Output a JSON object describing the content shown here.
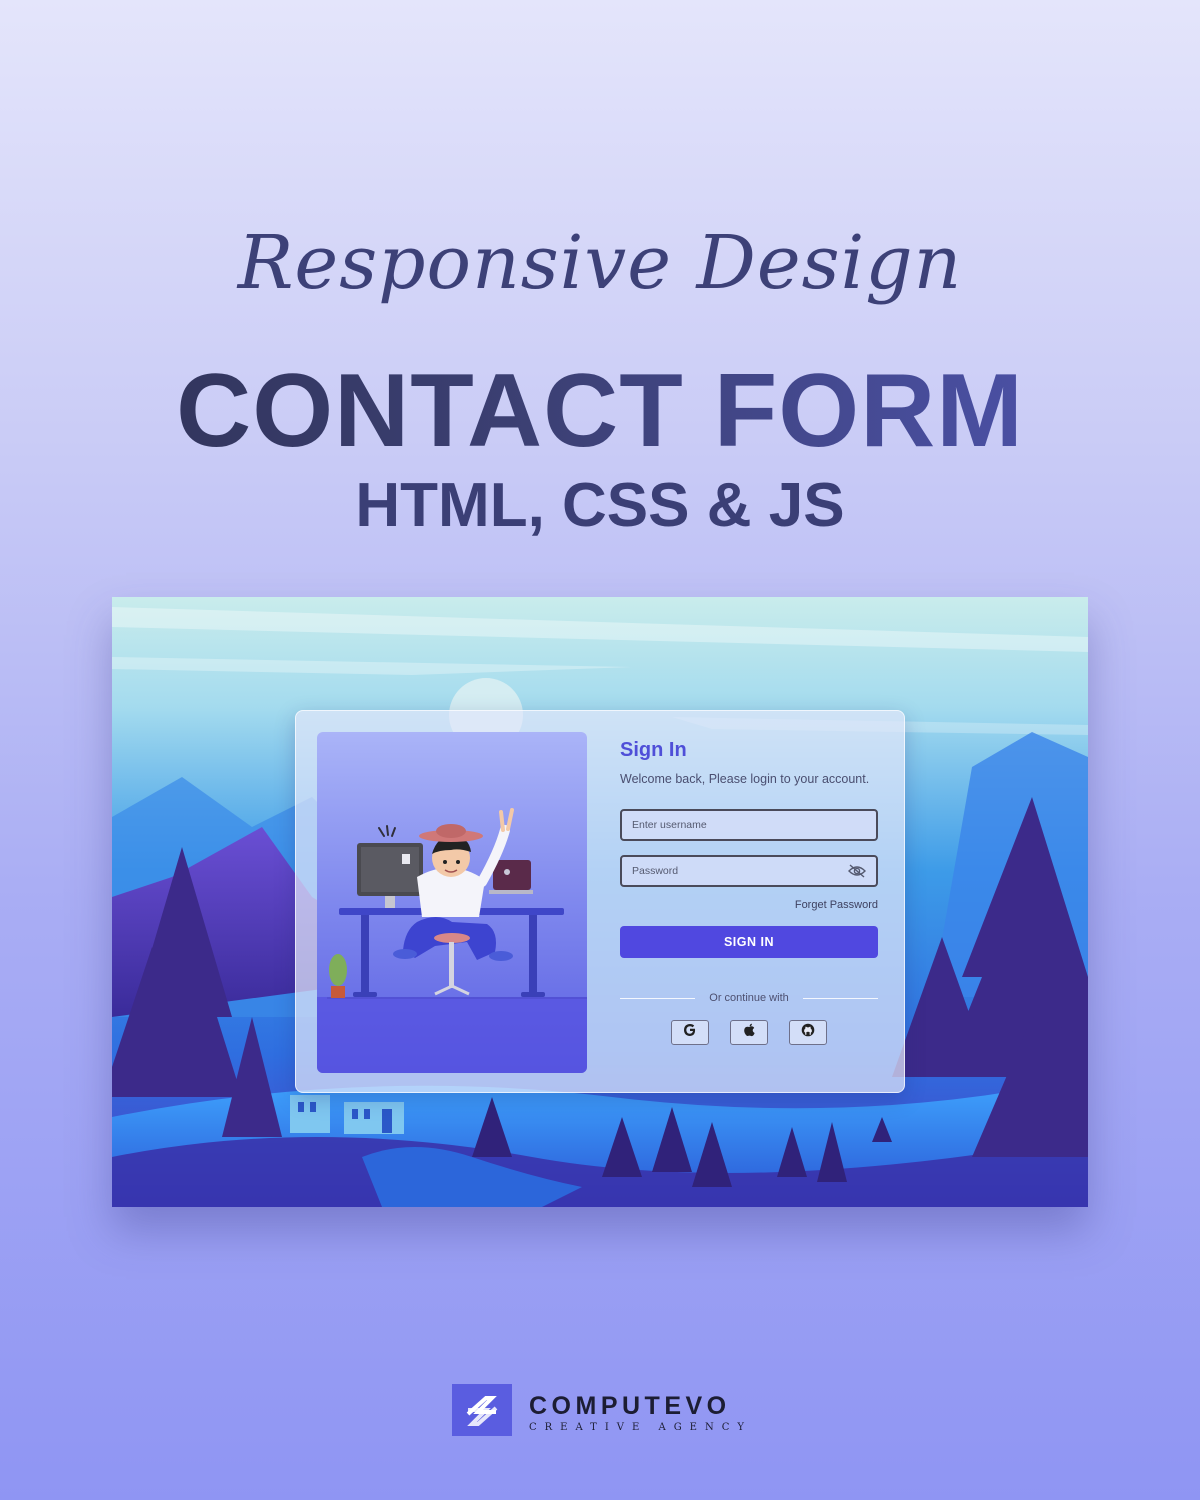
{
  "header": {
    "script_title": "Responsive Design",
    "main_title": "CONTACT FORM",
    "sub_title": "HTML, CSS & JS"
  },
  "login": {
    "title": "Sign In",
    "welcome": "Welcome back, Please login to your account.",
    "username_placeholder": "Enter username",
    "password_placeholder": "Password",
    "forget_password": "Forget Password",
    "sign_in_button": "SIGN IN",
    "divider_text": "Or continue with",
    "social_buttons": [
      "google-icon",
      "apple-icon",
      "github-icon"
    ]
  },
  "brand": {
    "name": "COMPUTEVO",
    "tagline": "CREATIVE AGENCY",
    "color": "#5a5de0"
  },
  "colors": {
    "accent": "#5048e0",
    "title_text": "#3b3f76"
  }
}
